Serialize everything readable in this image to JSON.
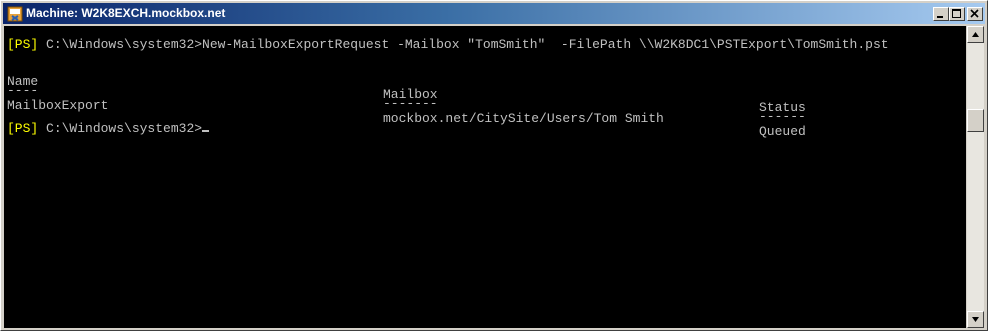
{
  "window": {
    "title": "Machine: W2K8EXCH.mockbox.net",
    "buttons": {
      "minimize": "minimize-icon",
      "maximize": "maximize-icon",
      "close": "close-icon"
    },
    "colors": {
      "titlebar_start": "#0a246a",
      "titlebar_end": "#a6caf0",
      "console_bg": "#000000",
      "console_text": "#c0c0c0",
      "prompt_tag": "#ffff00"
    }
  },
  "console": {
    "command_line": {
      "tag": "[PS]",
      "path": " C:\\Windows\\system32>",
      "command": "New-MailboxExportRequest -Mailbox \"TomSmith\"  -FilePath \\\\W2K8DC1\\PSTExport\\TomSmith.pst"
    },
    "table": {
      "headers": [
        "Name",
        "Mailbox",
        "Status"
      ],
      "underlines": [
        "----",
        "-------",
        "------"
      ],
      "rows": [
        [
          "MailboxExport",
          "mockbox.net/CitySite/Users/Tom Smith",
          "Queued"
        ]
      ]
    },
    "prompt_line": {
      "tag": "[PS]",
      "path": " C:\\Windows\\system32>"
    }
  }
}
